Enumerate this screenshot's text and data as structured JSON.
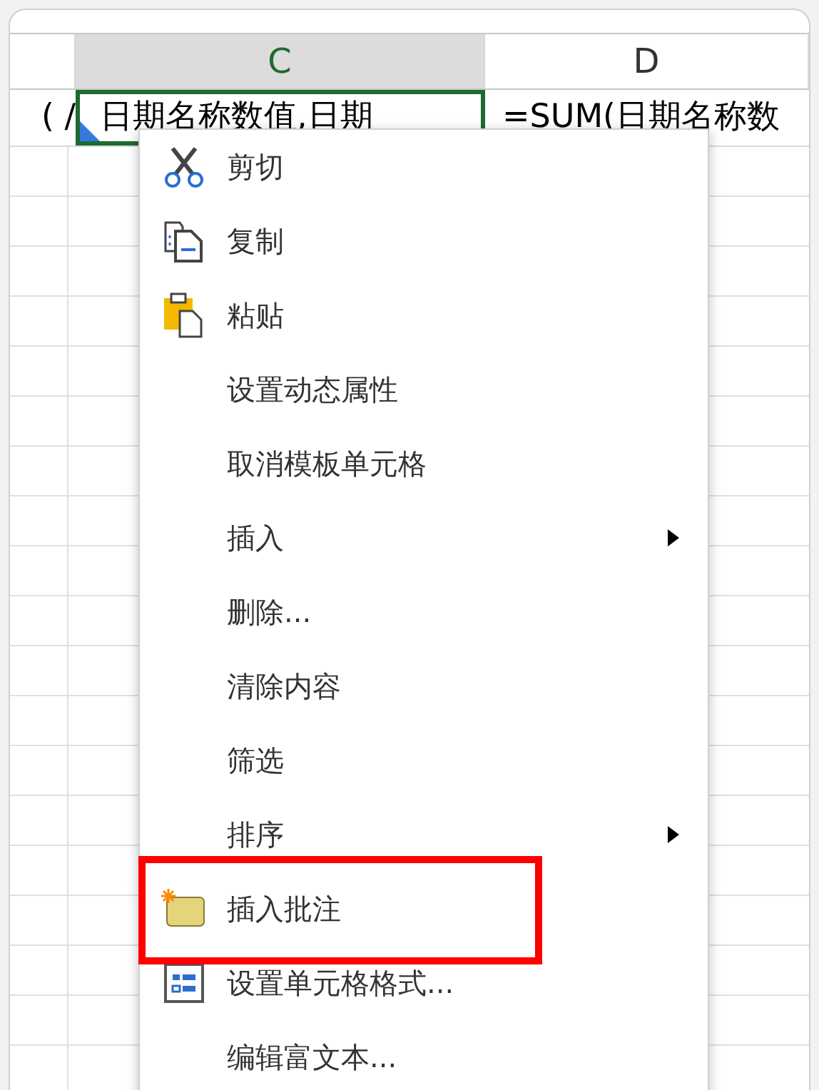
{
  "columns": [
    {
      "selected": false
    },
    {
      "label": "C",
      "selected": true
    },
    {
      "label": "D",
      "selected": false
    }
  ],
  "cells": [
    {
      "text": "( /",
      "selected": false
    },
    {
      "text": "日期名称数值,日期",
      "selected": true
    },
    {
      "text": "=SUM(日期名称数",
      "selected": false
    }
  ],
  "context_menu": [
    {
      "label": "剪切",
      "kind": "scissors",
      "submenu": false,
      "highlighted": false
    },
    {
      "label": "复制",
      "kind": "copy",
      "submenu": false,
      "highlighted": false
    },
    {
      "label": "粘贴",
      "kind": "paste",
      "submenu": false,
      "highlighted": false
    },
    {
      "label": "设置动态属性",
      "kind": "plain",
      "submenu": false,
      "highlighted": false
    },
    {
      "label": "取消模板单元格",
      "kind": "plain",
      "submenu": false,
      "highlighted": false
    },
    {
      "label": "插入",
      "kind": "plain",
      "submenu": true,
      "highlighted": false
    },
    {
      "label": "删除...",
      "kind": "plain",
      "submenu": false,
      "highlighted": false
    },
    {
      "label": "清除内容",
      "kind": "plain",
      "submenu": false,
      "highlighted": false
    },
    {
      "label": "筛选",
      "kind": "plain",
      "submenu": false,
      "highlighted": false
    },
    {
      "label": "排序",
      "kind": "plain",
      "submenu": true,
      "highlighted": false
    },
    {
      "label": "插入批注",
      "kind": "comment",
      "submenu": false,
      "highlighted": true
    },
    {
      "label": "设置单元格格式...",
      "kind": "format",
      "submenu": false,
      "highlighted": false
    },
    {
      "label": "编辑富文本...",
      "kind": "plain",
      "submenu": false,
      "highlighted": false
    }
  ]
}
